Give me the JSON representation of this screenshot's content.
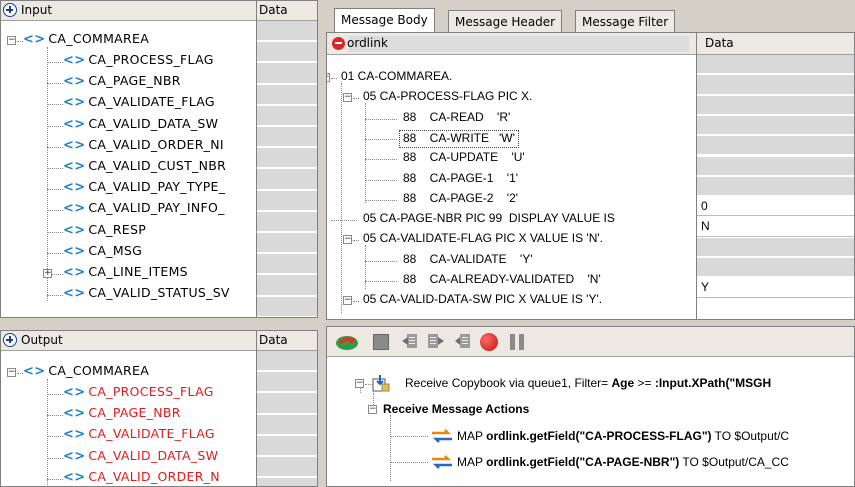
{
  "input_panel": {
    "header": "Input",
    "data_header": "Data",
    "root": "CA_COMMAREA",
    "items": [
      "CA_PROCESS_FLAG",
      "CA_PAGE_NBR",
      "CA_VALIDATE_FLAG",
      "CA_VALID_DATA_SW",
      "CA_VALID_ORDER_NI",
      "CA_VALID_CUST_NBR",
      "CA_VALID_PAY_TYPE_",
      "CA_VALID_PAY_INFO_",
      "CA_RESP",
      "CA_MSG",
      "CA_LINE_ITEMS",
      "CA_VALID_STATUS_SV"
    ]
  },
  "output_panel": {
    "header": "Output",
    "data_header": "Data",
    "root": "CA_COMMAREA",
    "items": [
      "CA_PROCESS_FLAG",
      "CA_PAGE_NBR",
      "CA_VALIDATE_FLAG",
      "CA_VALID_DATA_SW",
      "CA_VALID_ORDER_N"
    ]
  },
  "tabs": [
    "Message Body",
    "Message Header",
    "Message Filter"
  ],
  "message_body": {
    "col_name": "ordlink",
    "col_data": "Data",
    "rows": [
      {
        "text": "01 CA-COMMAREA.",
        "data": ""
      },
      {
        "text": "05 CA-PROCESS-FLAG PIC X.",
        "data": ""
      },
      {
        "text": "88    CA-READ    'R'",
        "data": ""
      },
      {
        "text": "88    CA-WRITE   'W'",
        "data": ""
      },
      {
        "text": "88    CA-UPDATE    'U'",
        "data": ""
      },
      {
        "text": "88    CA-PAGE-1    '1'",
        "data": ""
      },
      {
        "text": "88    CA-PAGE-2    '2'",
        "data": ""
      },
      {
        "text": "05 CA-PAGE-NBR PIC 99  DISPLAY VALUE IS",
        "data": "0"
      },
      {
        "text": "05 CA-VALIDATE-FLAG PIC X VALUE IS 'N'.",
        "data": "N"
      },
      {
        "text": "88    CA-VALIDATE    'Y'",
        "data": ""
      },
      {
        "text": "88    CA-ALREADY-VALIDATED    'N'",
        "data": ""
      },
      {
        "text": "05 CA-VALID-DATA-SW PIC X VALUE IS 'Y'.",
        "data": "Y"
      }
    ]
  },
  "actions": {
    "receive_prefix": "Receive Copybook via queue1, Filter=",
    "receive_bold1": "Age",
    "receive_mid": " >= ",
    "receive_bold2": ":Input.XPath(\"MSGH",
    "group_label": "Receive Message Actions",
    "map1_prefix": "MAP ",
    "map1_bold": "ordlink.getField(\"CA-PROCESS-FLAG\")",
    "map1_suffix": " TO $Output/C",
    "map2_prefix": "MAP ",
    "map2_bold": "ordlink.getField(\"CA-PAGE-NBR\")",
    "map2_suffix": " TO $Output/CA_CC"
  },
  "colors": {
    "tag": "#1e7fd0",
    "output_item": "#e01c1c",
    "data_cell": "#d9d9d9"
  }
}
